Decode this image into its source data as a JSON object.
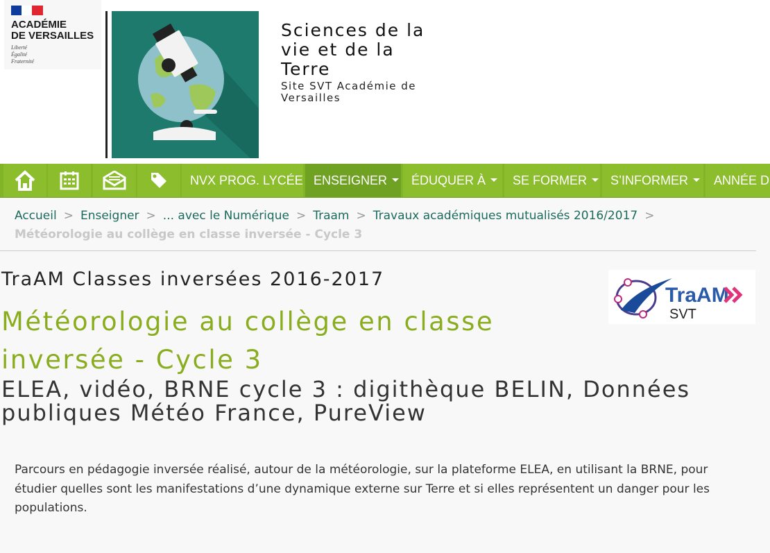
{
  "header": {
    "academy_name": "ACADÉMIE\nDE VERSAILLES",
    "academy_motto": "Liberté\nÉgalité\nFraternité",
    "site_title": "Sciences de la vie et de la Terre",
    "site_subtitle": "Site SVT Académie de Versailles",
    "logo_icon": "microscope-globe-icon",
    "colors": {
      "logo_bg": "#1e7a6c",
      "flag_blue": "#0f3c9c",
      "flag_red": "#e0262f"
    }
  },
  "nav": {
    "icons": [
      "home-icon",
      "calendar-icon",
      "mail-icon",
      "tag-icon"
    ],
    "items": [
      {
        "label": "NVX PROG. LYCÉE",
        "dropdown": false
      },
      {
        "label": "ENSEIGNER",
        "dropdown": true,
        "active": true
      },
      {
        "label": "ÉDUQUER À",
        "dropdown": true
      },
      {
        "label": "SE FORMER",
        "dropdown": true
      },
      {
        "label": "S’INFORMER",
        "dropdown": true
      },
      {
        "label": "ANNÉE D",
        "dropdown": false
      }
    ],
    "colors": {
      "bar": "#82b428",
      "active": "#6fa123"
    }
  },
  "breadcrumb": {
    "items": [
      "Accueil",
      "Enseigner",
      "... avec le Numérique",
      "Traam",
      "Travaux académiques mutualisés 2016/2017"
    ],
    "current": "Météorologie au collège en classe inversée - Cycle 3"
  },
  "article": {
    "surtitle": "TraAM Classes inversées 2016-2017",
    "title": "Météorologie au collège en classe inversée - Cycle 3",
    "subtitle": "ELEA, vidéo, BRNE cycle 3 : digithèque BELIN, Données publiques Météo France, PureView",
    "chapo": "Parcours en pédagogie inversée réalisé, autour de la météorologie, sur la plateforme ELEA, en utilisant la BRNE, pour étudier quelles sont les manifestations d’une dynamique externe sur Terre et si elles représentent un danger pour les populations.",
    "traam_logo": {
      "text": "TraAM",
      "sub": "SVT",
      "icon": "traam-logo-icon"
    },
    "colors": {
      "title": "#8aad20",
      "breadcrumb_link": "#1b6a5c"
    }
  }
}
